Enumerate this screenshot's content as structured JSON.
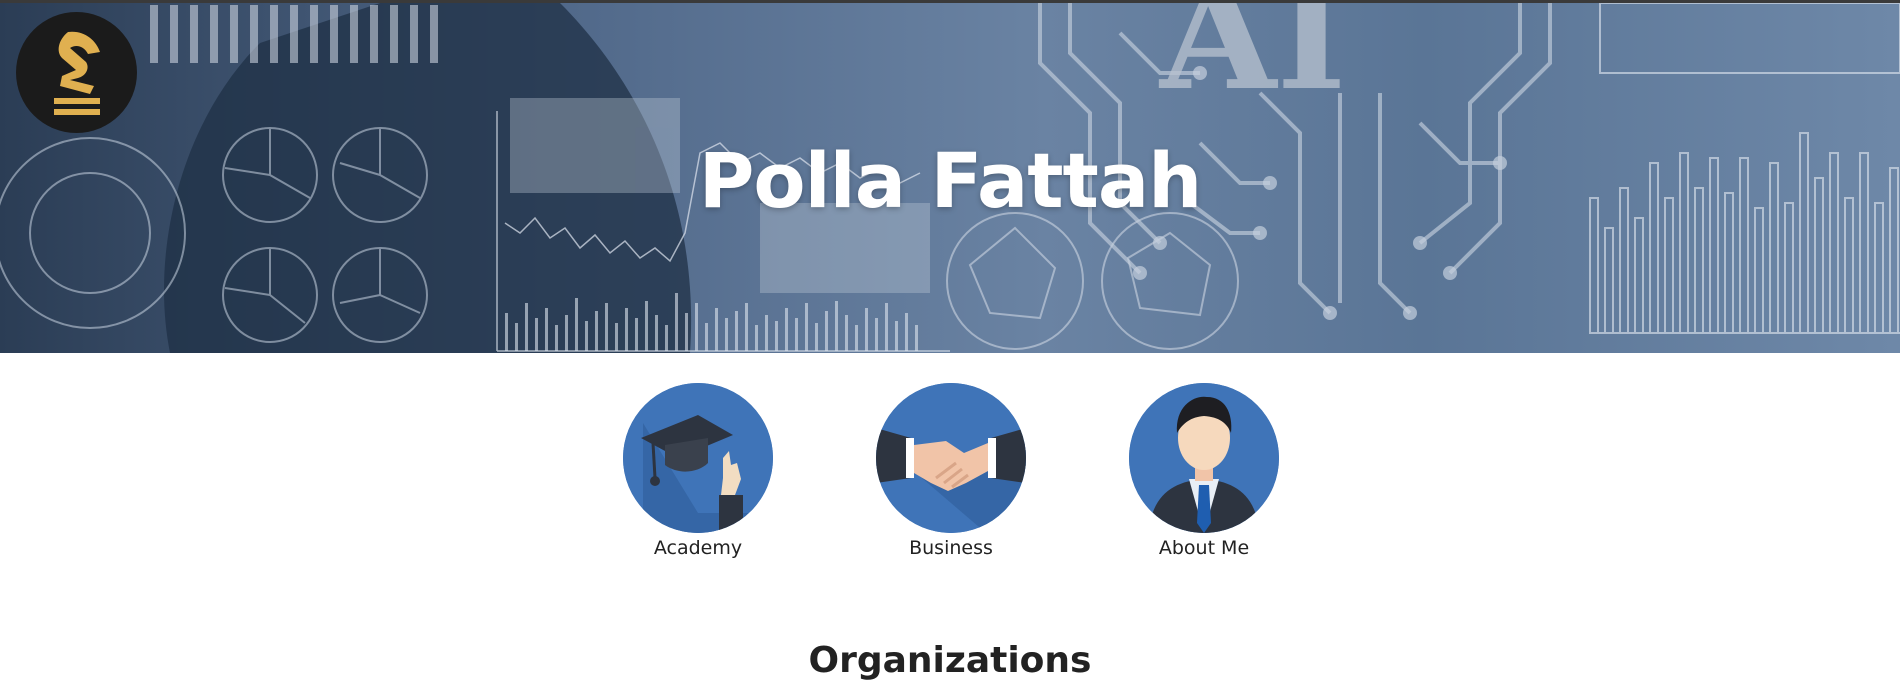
{
  "hero": {
    "title": "Polla Fattah"
  },
  "cards": [
    {
      "label": "Academy"
    },
    {
      "label": "Business"
    },
    {
      "label": "About Me"
    }
  ],
  "sections": {
    "organizations_title": "Organizations"
  },
  "icons": {
    "logo": "chess-knight-logo-icon",
    "academy": "graduation-cap-icon",
    "business": "handshake-icon",
    "about": "businessman-avatar-icon"
  },
  "colors": {
    "hero_bg": "#51698a",
    "card_bg": "#3f74b8",
    "logo_gold": "#e0b050"
  }
}
